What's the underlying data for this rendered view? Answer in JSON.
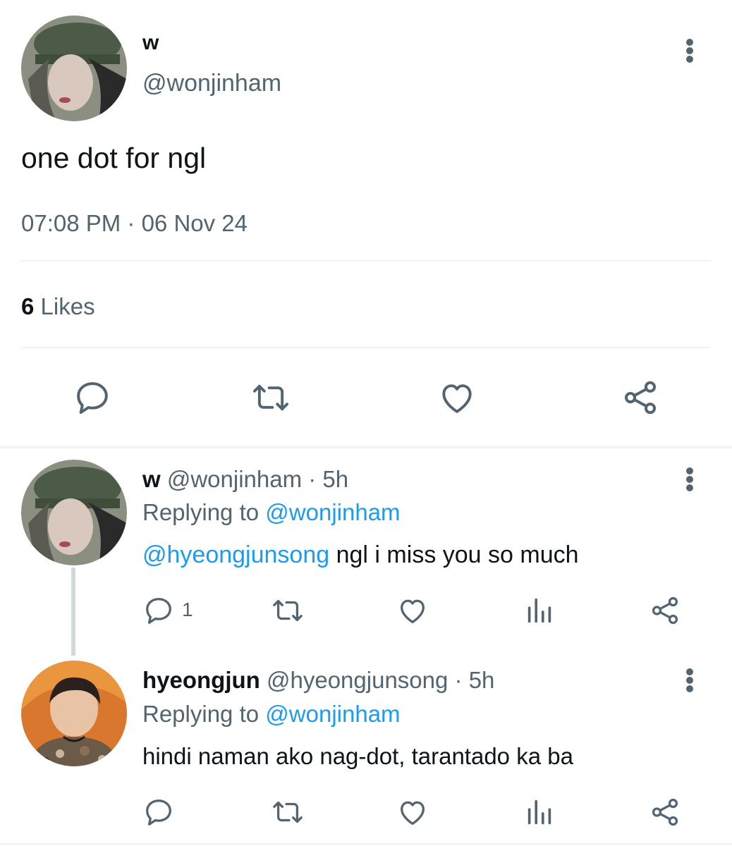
{
  "main_tweet": {
    "display_name": "w",
    "handle": "@wonjinham",
    "text": "one dot for ngl",
    "timestamp": "07:08 PM · 06 Nov 24",
    "likes_count": "6",
    "likes_label": "Likes"
  },
  "replies": [
    {
      "display_name": "w",
      "handle": "@wonjinham",
      "time": "· 5h",
      "replying_prefix": "Replying to",
      "replying_to": "@wonjinham",
      "mention": "@hyeongjunsong",
      "text": " ngl i miss you so much",
      "reply_count": "1"
    },
    {
      "display_name": "hyeongjun",
      "handle": "@hyeongjunsong",
      "time": "· 5h",
      "replying_prefix": "Replying to",
      "replying_to": "@wonjinham",
      "text": "hindi naman ako nag-dot, tarantado ka ba"
    }
  ],
  "colors": {
    "accent": "#1d9bf0",
    "icon_gray": "#536471",
    "divider": "#eff3f4"
  },
  "icons": [
    "avatar-wonjinham",
    "avatar-hyeongjun",
    "more-icon",
    "reply-icon",
    "retweet-icon",
    "like-icon",
    "views-icon",
    "share-icon"
  ]
}
